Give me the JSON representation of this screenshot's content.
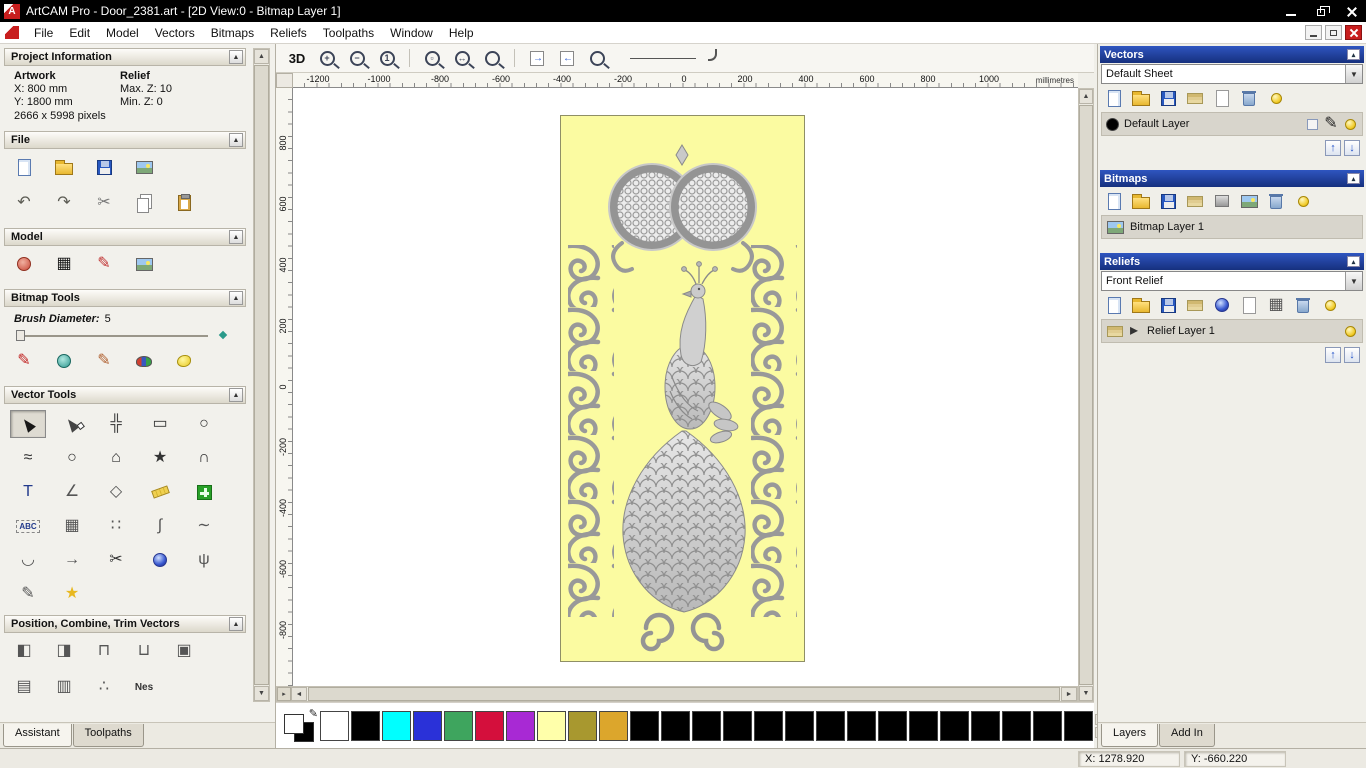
{
  "titlebar": {
    "logo_glyph": "A",
    "title": "ArtCAM Pro - Door_2381.art - [2D View:0 - Bitmap Layer 1]"
  },
  "menubar": {
    "items": [
      "File",
      "Edit",
      "Model",
      "Vectors",
      "Bitmaps",
      "Reliefs",
      "Toolpaths",
      "Window",
      "Help"
    ]
  },
  "assistant_panel": {
    "tabs": [
      {
        "label": "Assistant",
        "active": true
      },
      {
        "label": "Toolpaths",
        "active": false
      }
    ],
    "project_information": {
      "title": "Project Information",
      "artwork_header": "Artwork",
      "relief_header": "Relief",
      "rows": [
        {
          "left": "X: 800 mm",
          "right": "Max. Z: 10"
        },
        {
          "left": "Y: 1800 mm",
          "right": "Min. Z: 0"
        }
      ],
      "pixels": "2666 x 5998 pixels"
    },
    "file_section": {
      "title": "File",
      "row1": [
        {
          "name": "new-model",
          "cls": "ic-page"
        },
        {
          "name": "open-model",
          "cls": "ic-folder"
        },
        {
          "name": "save-model",
          "cls": "ic-disk"
        },
        {
          "name": "import-image",
          "cls": "ic-img"
        }
      ],
      "row2": [
        {
          "name": "undo",
          "glyph": "↶",
          "color": "#5a5a52"
        },
        {
          "name": "redo",
          "glyph": "↷",
          "color": "#5a5a52"
        },
        {
          "name": "cut",
          "glyph": "✂",
          "color": "#777"
        },
        {
          "name": "copy",
          "cls": "ic-copy"
        },
        {
          "name": "paste",
          "cls": "ic-paste"
        }
      ]
    },
    "model_section": {
      "title": "Model",
      "icons": [
        {
          "name": "set-model-size",
          "cls": "ic-face"
        },
        {
          "name": "adjust-model",
          "glyph": "▦",
          "color": "#181818"
        },
        {
          "name": "add-draft",
          "glyph": "✎",
          "color": "#c03030"
        },
        {
          "name": "load-reference-bitmap",
          "cls": "ic-img"
        }
      ]
    },
    "bitmap_tools": {
      "title": "Bitmap Tools",
      "brush_label": "Brush Diameter:",
      "brush_value": "5",
      "icons": [
        {
          "name": "paint-brush",
          "glyph": "✎",
          "color": "#c02020"
        },
        {
          "name": "flood-fill",
          "cls": "ic-flood"
        },
        {
          "name": "colour-picker",
          "glyph": "✎",
          "color": "#b06030"
        },
        {
          "name": "paint-selective",
          "cls": "ic-palette"
        },
        {
          "name": "reduce-colours",
          "cls": "ic-blob"
        }
      ]
    },
    "vector_tools": {
      "title": "Vector Tools",
      "rows": [
        [
          {
            "name": "select-vectors",
            "cls": "ic-cursor",
            "pressed": true
          },
          {
            "name": "node-editing",
            "cls": "ic-cursor-node"
          },
          {
            "name": "transform-vectors",
            "glyph": "╬",
            "color": "#444"
          },
          {
            "name": "create-rectangle",
            "glyph": "▭",
            "color": "#333"
          },
          {
            "name": "create-circle",
            "glyph": "○",
            "color": "#333"
          }
        ],
        [
          {
            "name": "create-polyline",
            "glyph": "≈",
            "color": "#333"
          },
          {
            "name": "create-ellipse",
            "glyph": "○",
            "color": "#333"
          },
          {
            "name": "create-polygon",
            "glyph": "⌂",
            "color": "#333"
          },
          {
            "name": "create-star",
            "glyph": "★",
            "color": "#333"
          },
          {
            "name": "create-arc",
            "glyph": "∩",
            "color": "#333"
          }
        ],
        [
          {
            "name": "create-text",
            "glyph": "T",
            "color": "#223a8c"
          },
          {
            "name": "measure-tool",
            "glyph": "∠",
            "color": "#555"
          },
          {
            "name": "offset-vectors",
            "glyph": "◇",
            "color": "#555"
          },
          {
            "name": "fillet-tool",
            "cls": "ic-ruleryellow"
          },
          {
            "name": "paste-along-curve",
            "cls": "ic-greencross"
          }
        ],
        [
          {
            "name": "wrap-text",
            "text": "ABC",
            "cls2": "ic-abc"
          },
          {
            "name": "block-copy",
            "glyph": "▦",
            "color": "#555"
          },
          {
            "name": "nest-objects",
            "glyph": "∷",
            "color": "#555"
          },
          {
            "name": "create-bezier",
            "glyph": "∫",
            "color": "#555"
          },
          {
            "name": "fit-curve",
            "glyph": "∼",
            "color": "#555"
          }
        ],
        [
          {
            "name": "close-vector",
            "glyph": "◡",
            "color": "#555"
          },
          {
            "name": "reverse-direction",
            "glyph": "→",
            "color": "#555"
          },
          {
            "name": "trim-vectors",
            "glyph": "✂",
            "color": "#333"
          },
          {
            "name": "interactive-trim",
            "cls": "ic-lens"
          },
          {
            "name": "join-vectors",
            "glyph": "ψ",
            "color": "#555"
          }
        ],
        [
          {
            "name": "vector-doctor",
            "glyph": "✎",
            "color": "#555"
          },
          {
            "name": "magic-wand",
            "glyph": "★",
            "color": "#e8b820"
          }
        ]
      ]
    },
    "position_section": {
      "title": "Position, Combine, Trim Vectors",
      "row1": [
        {
          "name": "align-left",
          "glyph": "◧",
          "color": "#555"
        },
        {
          "name": "align-right",
          "glyph": "◨",
          "color": "#555"
        },
        {
          "name": "align-top",
          "glyph": "⊓",
          "color": "#555"
        },
        {
          "name": "align-bottom",
          "glyph": "⊔",
          "color": "#555"
        },
        {
          "name": "align-centre",
          "glyph": "▣",
          "color": "#555"
        }
      ],
      "row2": [
        {
          "name": "group-vectors",
          "glyph": "▤",
          "color": "#555"
        },
        {
          "name": "ungroup-vectors",
          "glyph": "▥",
          "color": "#555"
        },
        {
          "name": "weld-vectors",
          "glyph": "∴",
          "color": "#555"
        },
        {
          "name": "nesting",
          "text": "Nes",
          "cls2": "ic-nes"
        }
      ]
    }
  },
  "canvas": {
    "toolbar_items": [
      {
        "name": "toggle-3d-view",
        "text": "3D"
      },
      {
        "name": "zoom-in",
        "zoom": "+"
      },
      {
        "name": "zoom-out",
        "zoom": "−"
      },
      {
        "name": "zoom-1-1",
        "zoom": "1"
      },
      {
        "sep": true
      },
      {
        "name": "zoom-box",
        "zoom": "▫"
      },
      {
        "name": "zoom-fit-page",
        "zoom": "↔"
      },
      {
        "name": "zoom-objects",
        "zoom": " "
      },
      {
        "sep": true
      },
      {
        "name": "pan-view-right",
        "cls": "ic-pager"
      },
      {
        "name": "pan-view-left",
        "cls": "ic-pagel"
      },
      {
        "name": "zoom-previous",
        "zoom": " "
      }
    ],
    "ruler_unit": "millimetres",
    "h_ticks": [
      -1200,
      -1000,
      -800,
      -600,
      -400,
      -200,
      0,
      200,
      400,
      600,
      800,
      1000
    ],
    "v_ticks": [
      800,
      600,
      400,
      200,
      0,
      -200,
      -400,
      -600,
      -800
    ]
  },
  "panels": {
    "vectors": {
      "title": "Vectors",
      "sheet": "Default Sheet",
      "layer": "Default Layer",
      "toolbar": [
        {
          "name": "new-vector-layer",
          "cls": "ic-page"
        },
        {
          "name": "open-vector-file",
          "cls": "ic-folder"
        },
        {
          "name": "save-vector-layer",
          "cls": "ic-disk"
        },
        {
          "name": "merge-vector-layers",
          "cls": "ic-stack"
        },
        {
          "name": "new-sheet",
          "cls": "ic-pagew"
        },
        {
          "name": "delete-vector-layer",
          "cls": "ic-trash"
        },
        {
          "name": "toggle-all-vector-visibility",
          "cls": "ic-bulb"
        }
      ],
      "layer_icons": [
        {
          "name": "toggle-snap",
          "cls": "ic-minibox"
        },
        {
          "name": "edit-vector-layer",
          "glyph": "✎",
          "color": "#222"
        },
        {
          "name": "vector-layer-visibility",
          "cls": "ic-bulb"
        }
      ],
      "arrows": [
        {
          "name": "vector-layer-up",
          "glyph": "↑",
          "color": "#2050c8"
        },
        {
          "name": "vector-layer-down",
          "glyph": "↓",
          "color": "#2050c8"
        }
      ]
    },
    "bitmaps": {
      "title": "Bitmaps",
      "layer": "Bitmap Layer 1",
      "toolbar": [
        {
          "name": "new-bitmap-layer",
          "cls": "ic-page"
        },
        {
          "name": "open-bitmap-file",
          "cls": "ic-folder"
        },
        {
          "name": "save-bitmap-layer",
          "cls": "ic-disk"
        },
        {
          "name": "merge-bitmap-layers",
          "cls": "ic-stack"
        },
        {
          "name": "greyscale-preview",
          "cls": "ic-graybox"
        },
        {
          "name": "bitmap-to-vector",
          "cls": "ic-img"
        },
        {
          "name": "delete-bitmap-layer",
          "cls": "ic-trash"
        },
        {
          "name": "toggle-all-bitmap-visibility",
          "cls": "ic-bulb"
        }
      ],
      "layer_left": [
        {
          "name": "bitmap-layer-thumb",
          "cls": "ic-img"
        }
      ]
    },
    "reliefs": {
      "title": "Reliefs",
      "selected": "Front Relief",
      "layer": "Relief Layer 1",
      "toolbar": [
        {
          "name": "new-relief-layer",
          "cls": "ic-page"
        },
        {
          "name": "open-relief-file",
          "cls": "ic-folder"
        },
        {
          "name": "save-relief-layer",
          "cls": "ic-disk"
        },
        {
          "name": "merge-relief-layers",
          "cls": "ic-stack"
        },
        {
          "name": "relief-preview",
          "cls": "ic-lens"
        },
        {
          "name": "new-relief-sheet",
          "cls": "ic-pagew"
        },
        {
          "name": "relief-grid",
          "glyph": "▦",
          "color": "#555"
        },
        {
          "name": "delete-relief-layer",
          "cls": "ic-trash"
        },
        {
          "name": "toggle-all-relief-visibility",
          "cls": "ic-bulb"
        }
      ],
      "layer_left": [
        {
          "name": "relief-layer-thumb",
          "cls": "ic-stack"
        },
        {
          "name": "expand-relief-layer",
          "glyph": "▸",
          "color": "#333"
        }
      ],
      "layer_icons": [
        {
          "name": "relief-layer-visibility",
          "cls": "ic-bulb"
        }
      ],
      "arrows": [
        {
          "name": "relief-layer-up",
          "glyph": "↑",
          "color": "#2050c8"
        },
        {
          "name": "relief-layer-down",
          "glyph": "↓",
          "color": "#2050c8"
        }
      ]
    },
    "tabs": [
      {
        "label": "Layers",
        "active": true
      },
      {
        "label": "Add In",
        "active": false
      }
    ]
  },
  "palette": {
    "colors": [
      "#ffffff",
      "#000000",
      "#00ffff",
      "#2a31d8",
      "#3ea55e",
      "#d40f3c",
      "#a829d4",
      "#ffffaa",
      "#a8982f",
      "#dca62c",
      "#000000",
      "#000000",
      "#000000",
      "#000000",
      "#000000",
      "#000000",
      "#000000",
      "#000000",
      "#000000",
      "#000000",
      "#000000",
      "#000000",
      "#000000",
      "#000000",
      "#000000"
    ]
  },
  "statusbar": {
    "x": "X: 1278.920",
    "y": "Y: -660.220"
  }
}
